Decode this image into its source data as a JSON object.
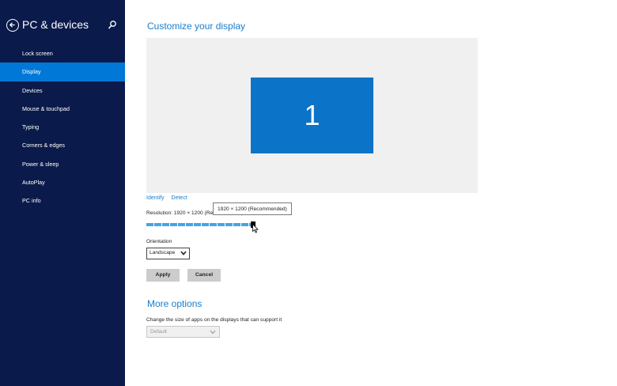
{
  "sidebar": {
    "title": "PC & devices",
    "items": [
      {
        "label": "Lock screen",
        "active": false
      },
      {
        "label": "Display",
        "active": true
      },
      {
        "label": "Devices",
        "active": false
      },
      {
        "label": "Mouse & touchpad",
        "active": false
      },
      {
        "label": "Typing",
        "active": false
      },
      {
        "label": "Corners & edges",
        "active": false
      },
      {
        "label": "Power & sleep",
        "active": false
      },
      {
        "label": "AutoPlay",
        "active": false
      },
      {
        "label": "PC info",
        "active": false
      }
    ]
  },
  "display": {
    "heading": "Customize your display",
    "monitor_number": "1",
    "identify_label": "Identify",
    "detect_label": "Detect",
    "resolution_label": "Resolution: 1920 × 1200 (Recommended)",
    "resolution_tooltip": "1920 × 1200 (Recommended)",
    "resolution_slider_value": 1.0,
    "orientation_label": "Orientation",
    "orientation_value": "Landscape",
    "apply_label": "Apply",
    "cancel_label": "Cancel"
  },
  "more_options": {
    "heading": "More options",
    "scale_label": "Change the size of apps on the displays that can support it",
    "scale_value": "Default",
    "scale_enabled": false
  },
  "icons": {
    "back": "back-arrow-icon",
    "search": "search-icon",
    "dropdown": "chevron-down-icon",
    "cursor": "mouse-pointer-icon"
  },
  "colors": {
    "sidebar_bg": "#0a1a4a",
    "active_item": "#0078d7",
    "accent": "#1c7dc9",
    "monitor": "#0b73c8"
  }
}
